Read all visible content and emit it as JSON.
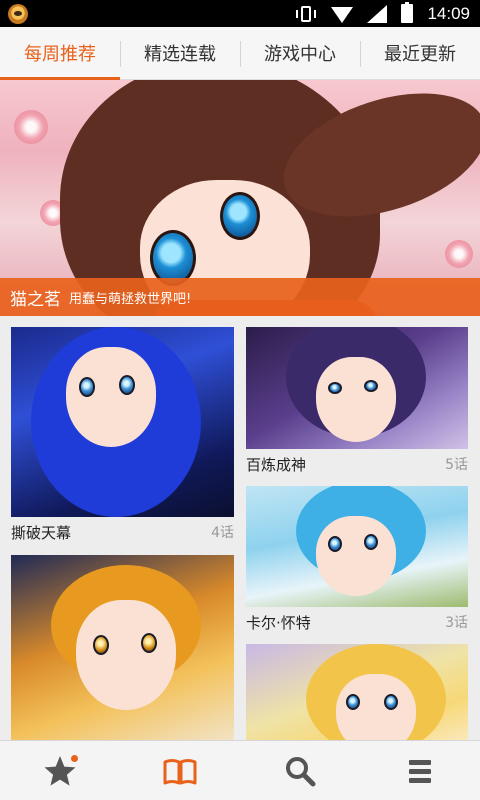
{
  "status_bar": {
    "time": "14:09",
    "icons": [
      "app-notification-icon",
      "vibrate-icon",
      "wifi-icon",
      "signal-icon",
      "battery-icon"
    ]
  },
  "tabs": [
    {
      "label": "每周推荐",
      "active": true
    },
    {
      "label": "精选连载",
      "active": false
    },
    {
      "label": "游戏中心",
      "active": false
    },
    {
      "label": "最近更新",
      "active": false
    }
  ],
  "banner": {
    "title": "猫之茗",
    "subtitle": "用蠢与萌拯救世界吧!"
  },
  "comics": [
    {
      "title": "撕破天幕",
      "chapters": "4话"
    },
    {
      "title": "百炼成神",
      "chapters": "5话"
    },
    {
      "title": "",
      "chapters": ""
    },
    {
      "title": "卡尔·怀特",
      "chapters": "3话"
    },
    {
      "title": "",
      "chapters": ""
    }
  ],
  "bottom_nav": [
    {
      "icon": "star-icon",
      "active": false,
      "has_notification_dot": true
    },
    {
      "icon": "book-icon",
      "active": true
    },
    {
      "icon": "search-icon",
      "active": false
    },
    {
      "icon": "menu-icon",
      "active": false
    }
  ],
  "colors": {
    "accent": "#e8621c",
    "inactive_icon": "#555555",
    "background": "#ededed"
  }
}
